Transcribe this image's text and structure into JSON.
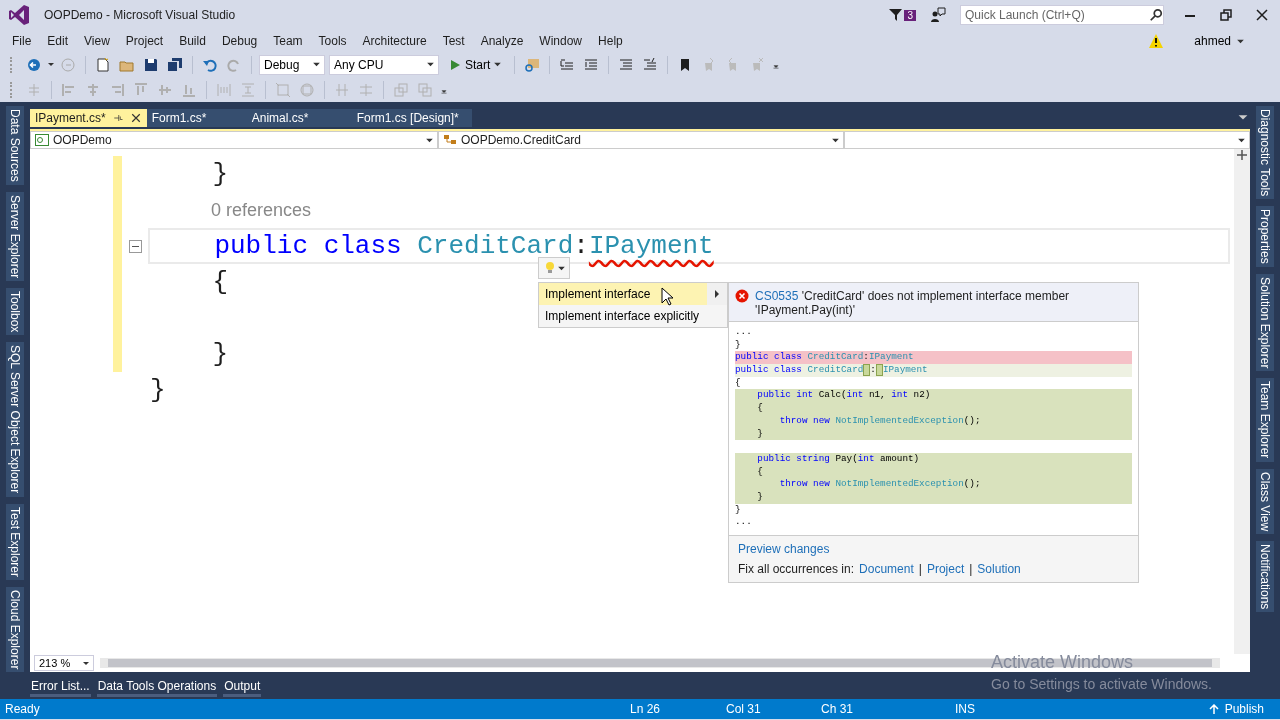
{
  "window": {
    "title": "OOPDemo - Microsoft Visual Studio",
    "notification_count": "3",
    "quick_launch": {
      "placeholder": "Quick Launch (Ctrl+Q)"
    }
  },
  "menu": [
    "File",
    "Edit",
    "View",
    "Project",
    "Build",
    "Debug",
    "Team",
    "Tools",
    "Architecture",
    "Test",
    "Analyze",
    "Window",
    "Help"
  ],
  "user": {
    "name": "ahmed"
  },
  "toolbar": {
    "configuration": "Debug",
    "platform": "Any CPU",
    "start": "Start"
  },
  "left_tool_tabs": [
    "Data Sources",
    "Server Explorer",
    "Toolbox",
    "SQL Server Object Explorer",
    "Test Explorer",
    "Cloud Explorer"
  ],
  "right_tool_tabs": [
    "Diagnostic Tools",
    "Properties",
    "Solution Explorer",
    "Team Explorer",
    "Class View",
    "Notifications"
  ],
  "doc_tabs": [
    {
      "label": "IPayment.cs*",
      "selected": true
    },
    {
      "label": "Form1.cs*",
      "selected": false
    },
    {
      "label": "Animal.cs*",
      "selected": false
    },
    {
      "label": "Form1.cs [Design]*",
      "selected": false
    }
  ],
  "nav_bar": {
    "project": "OOPDemo",
    "type": "OOPDemo.CreditCard"
  },
  "editor": {
    "zoom": "213 %",
    "lines": [
      {
        "kind": "code",
        "modified": true,
        "collapsible": false,
        "tokens": [
          {
            "kind": "plain",
            "text": "    }"
          }
        ]
      },
      {
        "kind": "lens",
        "modified": true,
        "collapsible": false,
        "text": "0 references"
      },
      {
        "kind": "code",
        "modified": true,
        "collapsible": true,
        "current": true,
        "tokens": [
          {
            "kind": "keyword",
            "text": "    public class "
          },
          {
            "kind": "type",
            "text": "CreditCard"
          },
          {
            "kind": "plain",
            "text": ":"
          },
          {
            "kind": "error",
            "text": "IPayment"
          }
        ]
      },
      {
        "kind": "code",
        "modified": true,
        "collapsible": false,
        "tokens": [
          {
            "kind": "plain",
            "text": "    {"
          }
        ]
      },
      {
        "kind": "code",
        "modified": true,
        "collapsible": false
      },
      {
        "kind": "code",
        "modified": true,
        "collapsible": false,
        "tokens": [
          {
            "kind": "plain",
            "text": "    }"
          }
        ]
      },
      {
        "kind": "code",
        "modified": false,
        "collapsible": false,
        "tokens": [
          {
            "kind": "plain",
            "text": "}"
          }
        ]
      }
    ]
  },
  "quick_actions": {
    "items": [
      {
        "label": "Implement interface",
        "selected": true
      },
      {
        "label": "Implement interface explicitly",
        "selected": false
      }
    ],
    "preview": {
      "code": "CS0535",
      "message": "'CreditCard' does not implement interface member 'IPayment.Pay(int)'",
      "lines": [
        {
          "kind": "context",
          "tokens": [
            {
              "kind": "plain",
              "text": "..."
            }
          ]
        },
        {
          "kind": "context",
          "tokens": [
            {
              "kind": "plain",
              "text": "}"
            }
          ]
        },
        {
          "kind": "removed",
          "tokens": [
            {
              "kind": "keyword",
              "text": "public class "
            },
            {
              "kind": "type",
              "text": "CreditCard"
            },
            {
              "kind": "plain",
              "text": ":"
            },
            {
              "kind": "type",
              "text": "IPayment"
            }
          ]
        },
        {
          "kind": "modified",
          "tokens": [
            {
              "kind": "keyword",
              "text": "public class "
            },
            {
              "kind": "type",
              "text": "CreditCard"
            },
            {
              "kind": "inserted_space"
            },
            {
              "kind": "plain",
              "text": ":"
            },
            {
              "kind": "inserted_space"
            },
            {
              "kind": "type",
              "text": "IPayment"
            }
          ]
        },
        {
          "kind": "context",
          "tokens": [
            {
              "kind": "plain",
              "text": "{"
            }
          ]
        },
        {
          "kind": "added",
          "tokens": [
            {
              "kind": "keyword",
              "text": "    public int"
            },
            {
              "kind": "plain",
              "text": " Calc("
            },
            {
              "kind": "keyword",
              "text": "int"
            },
            {
              "kind": "plain",
              "text": " n1, "
            },
            {
              "kind": "keyword",
              "text": "int"
            },
            {
              "kind": "plain",
              "text": " n2)"
            }
          ]
        },
        {
          "kind": "added",
          "tokens": [
            {
              "kind": "plain",
              "text": "    {"
            }
          ]
        },
        {
          "kind": "added",
          "tokens": [
            {
              "kind": "keyword",
              "text": "        throw new "
            },
            {
              "kind": "type",
              "text": "NotImplementedException"
            },
            {
              "kind": "plain",
              "text": "();"
            }
          ]
        },
        {
          "kind": "added",
          "tokens": [
            {
              "kind": "plain",
              "text": "    }"
            }
          ]
        },
        {
          "kind": "context"
        },
        {
          "kind": "added",
          "tokens": [
            {
              "kind": "keyword",
              "text": "    public string"
            },
            {
              "kind": "plain",
              "text": " Pay("
            },
            {
              "kind": "keyword",
              "text": "int"
            },
            {
              "kind": "plain",
              "text": " amount)"
            }
          ]
        },
        {
          "kind": "added",
          "tokens": [
            {
              "kind": "plain",
              "text": "    {"
            }
          ]
        },
        {
          "kind": "added",
          "tokens": [
            {
              "kind": "keyword",
              "text": "        throw new "
            },
            {
              "kind": "type",
              "text": "NotImplementedException"
            },
            {
              "kind": "plain",
              "text": "();"
            }
          ]
        },
        {
          "kind": "added",
          "tokens": [
            {
              "kind": "plain",
              "text": "    }"
            }
          ]
        },
        {
          "kind": "context",
          "tokens": [
            {
              "kind": "plain",
              "text": "}"
            }
          ]
        },
        {
          "kind": "context",
          "tokens": [
            {
              "kind": "plain",
              "text": "..."
            }
          ]
        }
      ],
      "preview_link": "Preview changes",
      "fix_all_label": "Fix all occurrences in:",
      "scopes": [
        {
          "kind": "link",
          "text": "Document"
        },
        {
          "kind": "separator",
          "text": "|"
        },
        {
          "kind": "link",
          "text": "Project"
        },
        {
          "kind": "separator",
          "text": "|"
        },
        {
          "kind": "link",
          "text": "Solution"
        }
      ]
    }
  },
  "bottom_tabs": [
    "Error List...",
    "Data Tools Operations",
    "Output"
  ],
  "status_bar": {
    "state": "Ready",
    "line": "Ln 26",
    "column": "Col 31",
    "char": "Ch 31",
    "mode": "INS",
    "publish": "Publish"
  },
  "activation": {
    "title": "Activate Windows",
    "message": "Go to Settings to activate Windows."
  }
}
